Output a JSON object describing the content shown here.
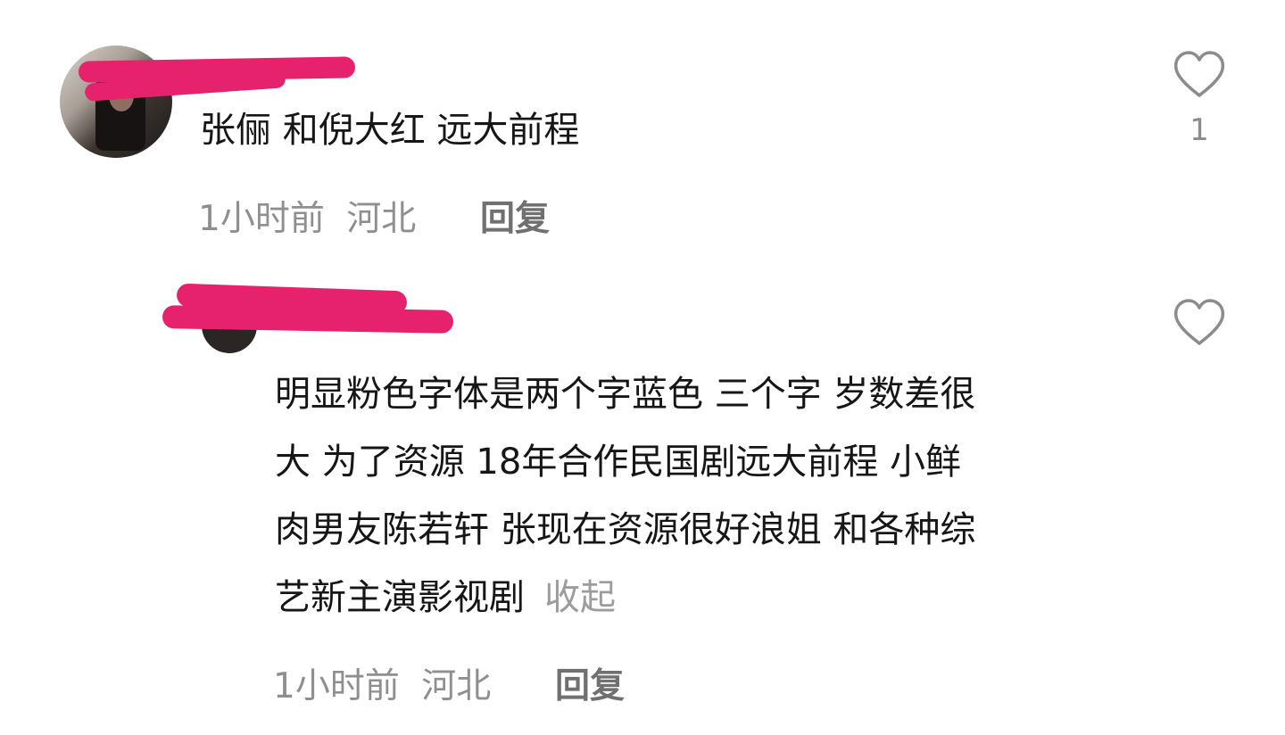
{
  "comments": [
    {
      "username": "",
      "text": "张俪 和倪大红 远大前程",
      "time": "1小时前",
      "location": "河北",
      "reply_label": "回复",
      "like_count": "1",
      "icons": {
        "avatar": "user-avatar",
        "like": "heart-outline-icon"
      }
    },
    {
      "username": "",
      "text_lines": [
        "明显粉色字体是两个字蓝色 三个字 岁数差很",
        "大 为了资源 18年合作民国剧远大前程  小鲜",
        "肉男友陈若轩 张现在资源很好浪姐 和各种综",
        "艺新主演影视剧"
      ],
      "collapse_label": "收起",
      "time": "1小时前",
      "location": "河北",
      "reply_label": "回复",
      "icons": {
        "avatar": "user-avatar",
        "like": "heart-outline-icon"
      }
    }
  ],
  "colors": {
    "redaction": "#e5226b",
    "text": "#161616",
    "meta": "#8f8f8f",
    "icon": "#8c8c8c"
  }
}
